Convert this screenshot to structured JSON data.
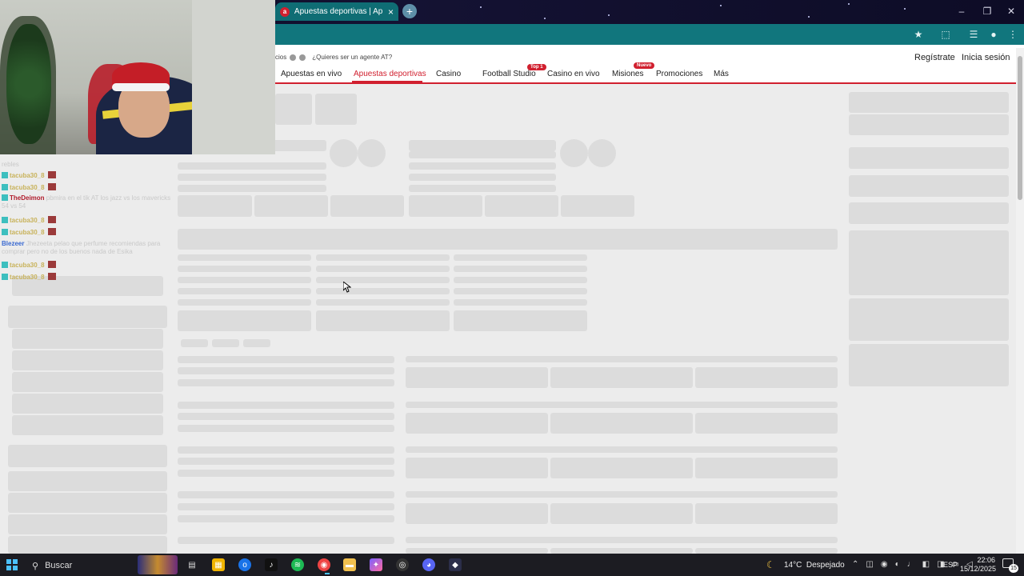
{
  "browser": {
    "tab_title": "Apuestas deportivas | Apuestas",
    "tab_close": "×",
    "new_tab": "+",
    "tab_favicon": "a",
    "window_controls": [
      "–",
      "❐",
      "✕"
    ]
  },
  "site": {
    "top_links": [
      "cios",
      "¿Quieres ser un agente AT?"
    ],
    "nav": [
      {
        "label": "Apuestas en vivo"
      },
      {
        "label": "Apuestas deportivas"
      },
      {
        "label": "Casino"
      },
      {
        "label": "Football Studio",
        "badge": "Top 1"
      },
      {
        "label": "Casino en vivo"
      },
      {
        "label": "Misiones",
        "badge": "Nuevo"
      },
      {
        "label": "Promociones"
      },
      {
        "label": "Más"
      }
    ],
    "register": "Regístrate",
    "login": "Inicia sesión",
    "accent_color": "#d1202f"
  },
  "chat": [
    {
      "user": "tacuba30_8",
      "msg": "",
      "color": "gold"
    },
    {
      "user": "tacuba30_8",
      "msg": "",
      "color": "gold"
    },
    {
      "user": "TheDeimon",
      "msg": "pbmira en el tik AT los jazz vs los mavericks 54 vs 54",
      "color": "red"
    },
    {
      "user": "tacuba30_8",
      "msg": "",
      "color": "gold"
    },
    {
      "user": "tacuba30_8",
      "msg": "",
      "color": "gold"
    },
    {
      "user": "Blezeer",
      "msg": "Jhezeeta pelao que perfume recomiendas para comprar pero no de los buenos nada de Esika",
      "color": "blue"
    },
    {
      "user": "tacuba30_8",
      "msg": "",
      "color": "gold"
    },
    {
      "user": "tacuba30_8",
      "msg": "",
      "color": "gold"
    }
  ],
  "chat_top_fragment": "rebles",
  "taskbar": {
    "search_placeholder": "Buscar",
    "weather": "14°C  Despejado",
    "language": "ESP",
    "time": "22:06",
    "date": "15/12/2025",
    "notifications": "15"
  }
}
